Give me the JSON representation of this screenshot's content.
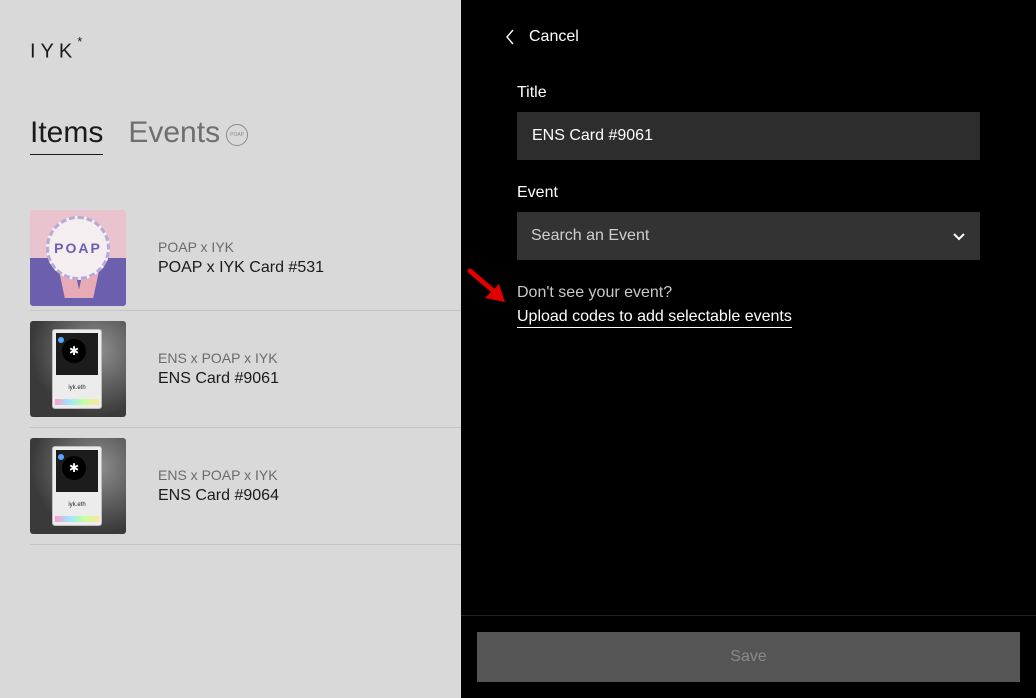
{
  "logo": {
    "text": "IYK",
    "mark": "*"
  },
  "tabs": [
    {
      "label": "Items",
      "active": true
    },
    {
      "label": "Events",
      "active": false,
      "badge": "POAP"
    }
  ],
  "items": [
    {
      "brand": "POAP x IYK",
      "name": "POAP x IYK Card #531",
      "thumb": {
        "text": "POAP"
      }
    },
    {
      "brand": "ENS x POAP x IYK",
      "name": "ENS Card #9061",
      "thumb": {
        "text": "iyk.eth"
      }
    },
    {
      "brand": "ENS x POAP x IYK",
      "name": "ENS Card #9064",
      "thumb": {
        "text": "iyk.eth"
      }
    }
  ],
  "panel": {
    "cancel_label": "Cancel",
    "title_label": "Title",
    "title_value": "ENS Card #9061",
    "event_label": "Event",
    "event_placeholder": "Search an Event",
    "hint": "Don't see your event?",
    "upload_link": "Upload codes to add selectable events",
    "save_label": "Save"
  },
  "colors": {
    "panel_bg": "#000000",
    "left_bg": "#d9d9d9",
    "input_bg": "#2d2d2d",
    "save_bg": "#555555",
    "annotation_arrow": "#e00000"
  }
}
